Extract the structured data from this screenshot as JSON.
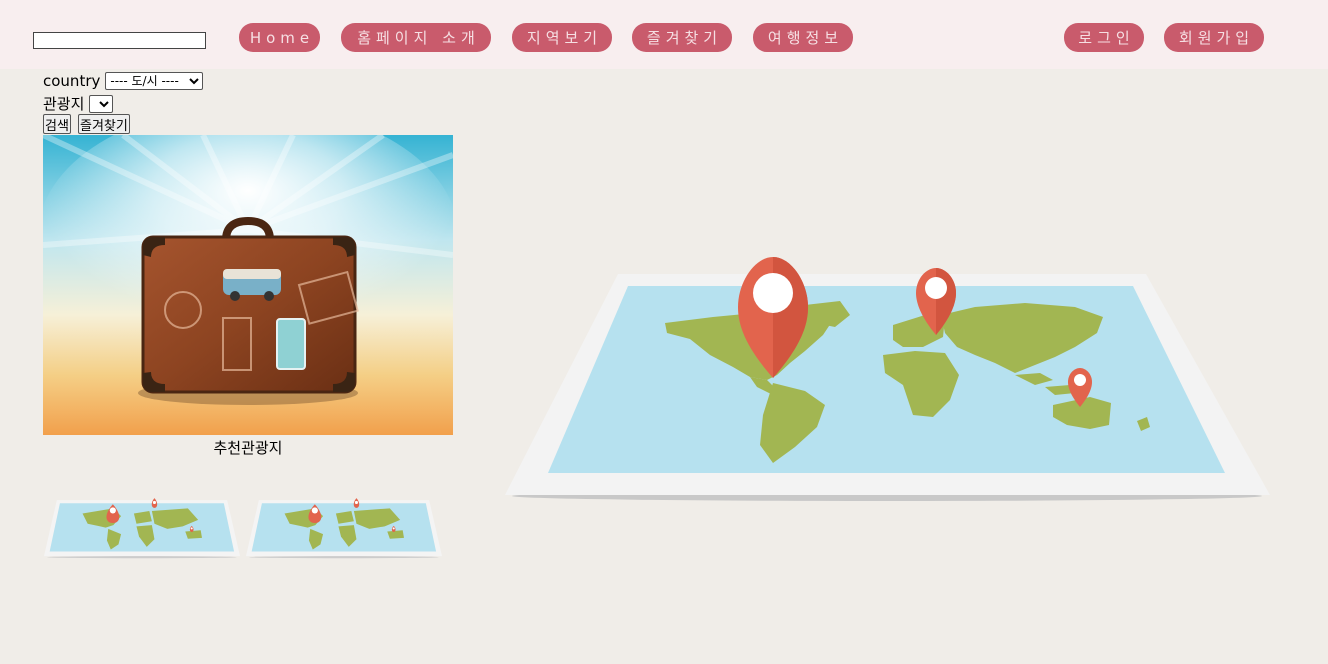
{
  "header": {
    "search_value": "",
    "nav": [
      "Home",
      "홈페이지 소개",
      "지역보기",
      "즐겨찾기",
      "여행정보"
    ],
    "auth": [
      "로그인",
      "회원가입"
    ]
  },
  "form": {
    "country_label": "country",
    "city_selected": "---- 도/시 ----",
    "spot_label": "관광지",
    "spot_selected": "",
    "search_button": "검색",
    "favorite_button": "즐겨찾기"
  },
  "main": {
    "caption": "추천관광지",
    "thumbnail_count": 2
  },
  "colors": {
    "nav_bg": "#c95b6c",
    "nav_text": "#f6dfe3",
    "header_bg": "#f8eeef",
    "page_bg": "#f0ede8",
    "map_water": "#b6e1ef",
    "map_land": "#a2b652",
    "pin": "#e2644d"
  },
  "icons": {
    "pin": "map-pin-icon",
    "map": "world-map-icon"
  }
}
